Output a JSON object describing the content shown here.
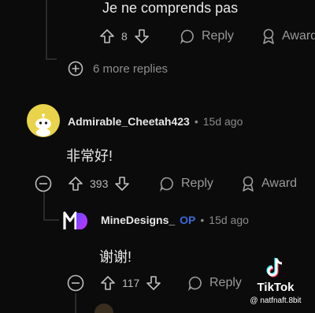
{
  "top_reply": {
    "text": "Je ne comprends pas",
    "votes": "8",
    "reply_label": "Reply",
    "award_label": "Award"
  },
  "more_replies": "6 more replies",
  "comment1": {
    "username": "Admirable_Cheetah423",
    "timestamp": "15d ago",
    "text": "非常好!",
    "votes": "393",
    "reply_label": "Reply",
    "award_label": "Award"
  },
  "comment2": {
    "username": "MineDesigns_",
    "badge": "OP",
    "timestamp": "15d ago",
    "text": "谢谢!",
    "votes": "117",
    "reply_label": "Reply"
  },
  "watermark": {
    "brand": "TikTok",
    "handle": "@ natfnaft.8bit"
  },
  "colors": {
    "avatar_yellow": "#e9d34a",
    "op_blue": "#3b6ad9",
    "md_gradient_start": "#6a48ff",
    "md_gradient_end": "#c633ff"
  }
}
